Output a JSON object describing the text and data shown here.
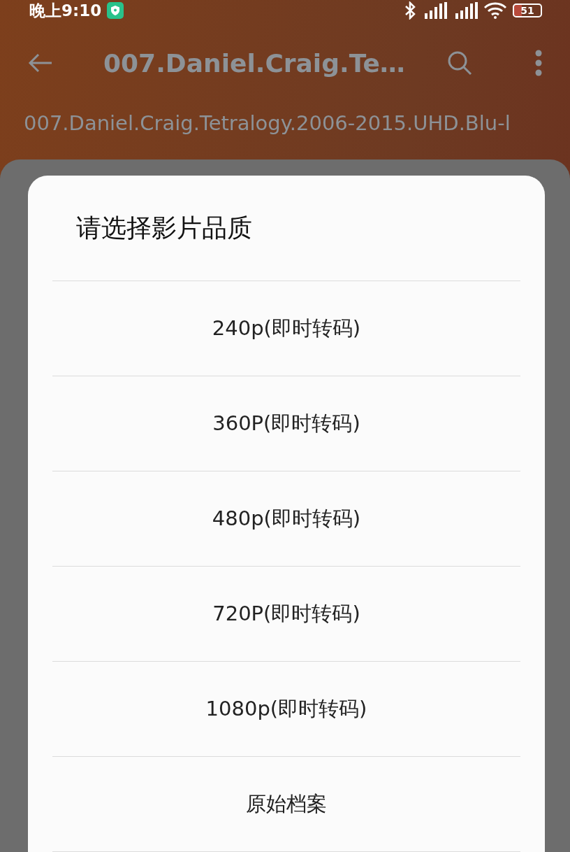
{
  "status_bar": {
    "time": "晚上9:10",
    "battery": "51"
  },
  "toolbar": {
    "title": "007.Daniel.Craig.Te…"
  },
  "path": "007.Daniel.Craig.Tetralogy.2006-2015.UHD.Blu-l",
  "dialog": {
    "title": "请选择影片品质",
    "options": [
      {
        "label": "240p(即时转码)"
      },
      {
        "label": "360P(即时转码)"
      },
      {
        "label": "480p(即时转码)"
      },
      {
        "label": "720P(即时转码)"
      },
      {
        "label": "1080p(即时转码)"
      },
      {
        "label": "原始档案"
      }
    ]
  }
}
